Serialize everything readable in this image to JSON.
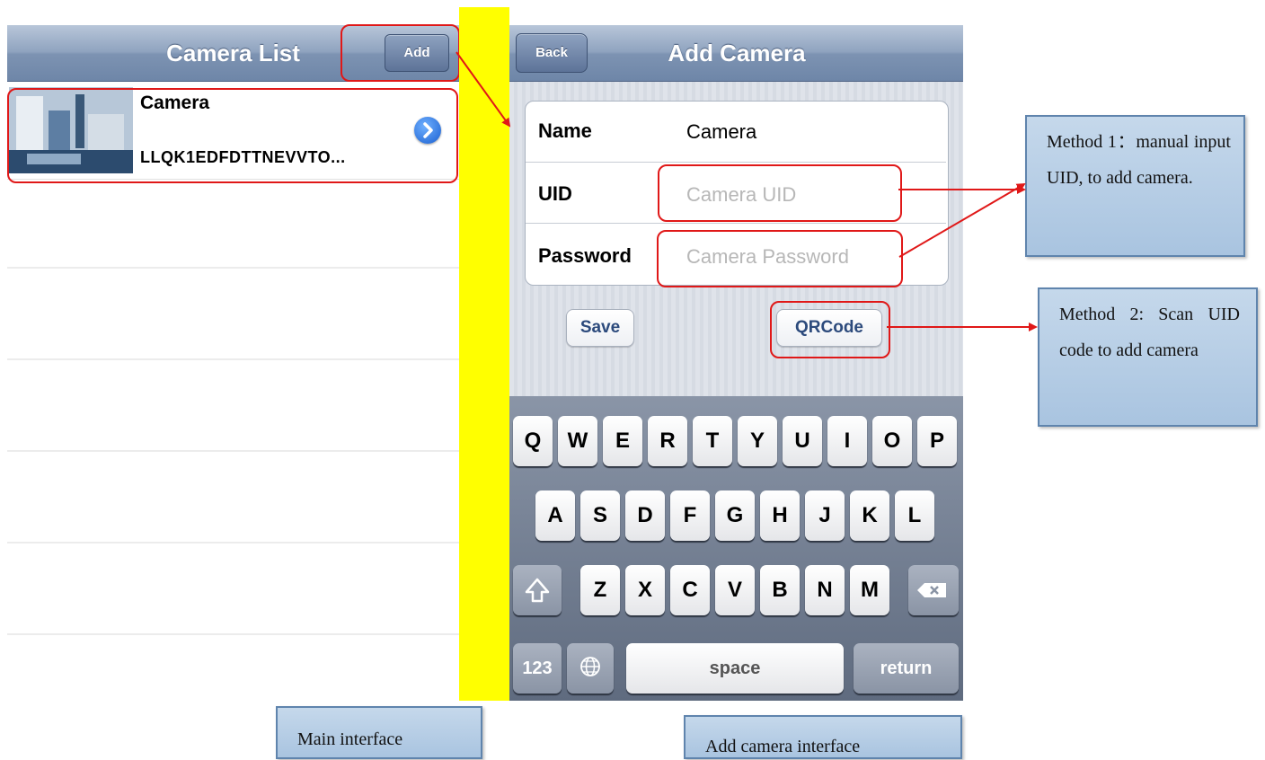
{
  "camera_list": {
    "title": "Camera List",
    "add_label": "Add",
    "items": [
      {
        "name": "Camera",
        "uid": "LLQK1EDFDTTNEVVTO..."
      }
    ]
  },
  "add_camera": {
    "title": "Add Camera",
    "back_label": "Back",
    "fields": {
      "name": {
        "label": "Name",
        "value": "Camera"
      },
      "uid": {
        "label": "UID",
        "placeholder": "Camera UID"
      },
      "password": {
        "label": "Password",
        "placeholder": "Camera Password"
      }
    },
    "save_label": "Save",
    "qrcode_label": "QRCode"
  },
  "keyboard": {
    "row1": [
      "Q",
      "W",
      "E",
      "R",
      "T",
      "Y",
      "U",
      "I",
      "O",
      "P"
    ],
    "row2": [
      "A",
      "S",
      "D",
      "F",
      "G",
      "H",
      "J",
      "K",
      "L"
    ],
    "row3": [
      "Z",
      "X",
      "C",
      "V",
      "B",
      "N",
      "M"
    ],
    "numbers_label": "123",
    "space_label": "space",
    "return_label": "return"
  },
  "annotations": {
    "method1": "Method 1：manual input UID, to add camera.",
    "method2": "Method 2: Scan UID code to add camera",
    "main_caption": "Main interface",
    "add_caption": "Add camera interface"
  },
  "colors": {
    "highlight": "#e01818",
    "divider": "#ffff00",
    "callout_fill": "#b8cee6"
  }
}
